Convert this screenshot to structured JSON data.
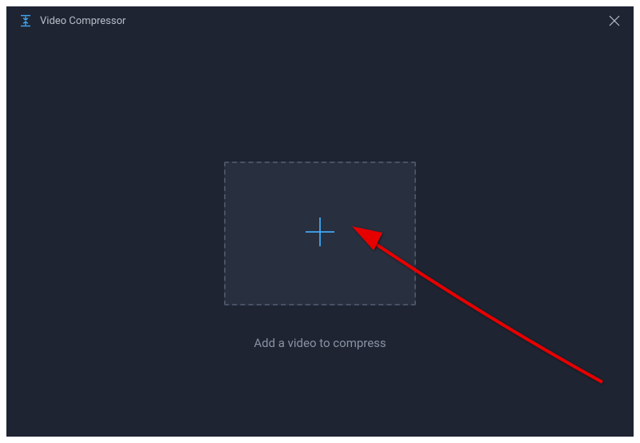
{
  "header": {
    "title": "Video Compressor"
  },
  "main": {
    "instruction": "Add a video to compress"
  }
}
